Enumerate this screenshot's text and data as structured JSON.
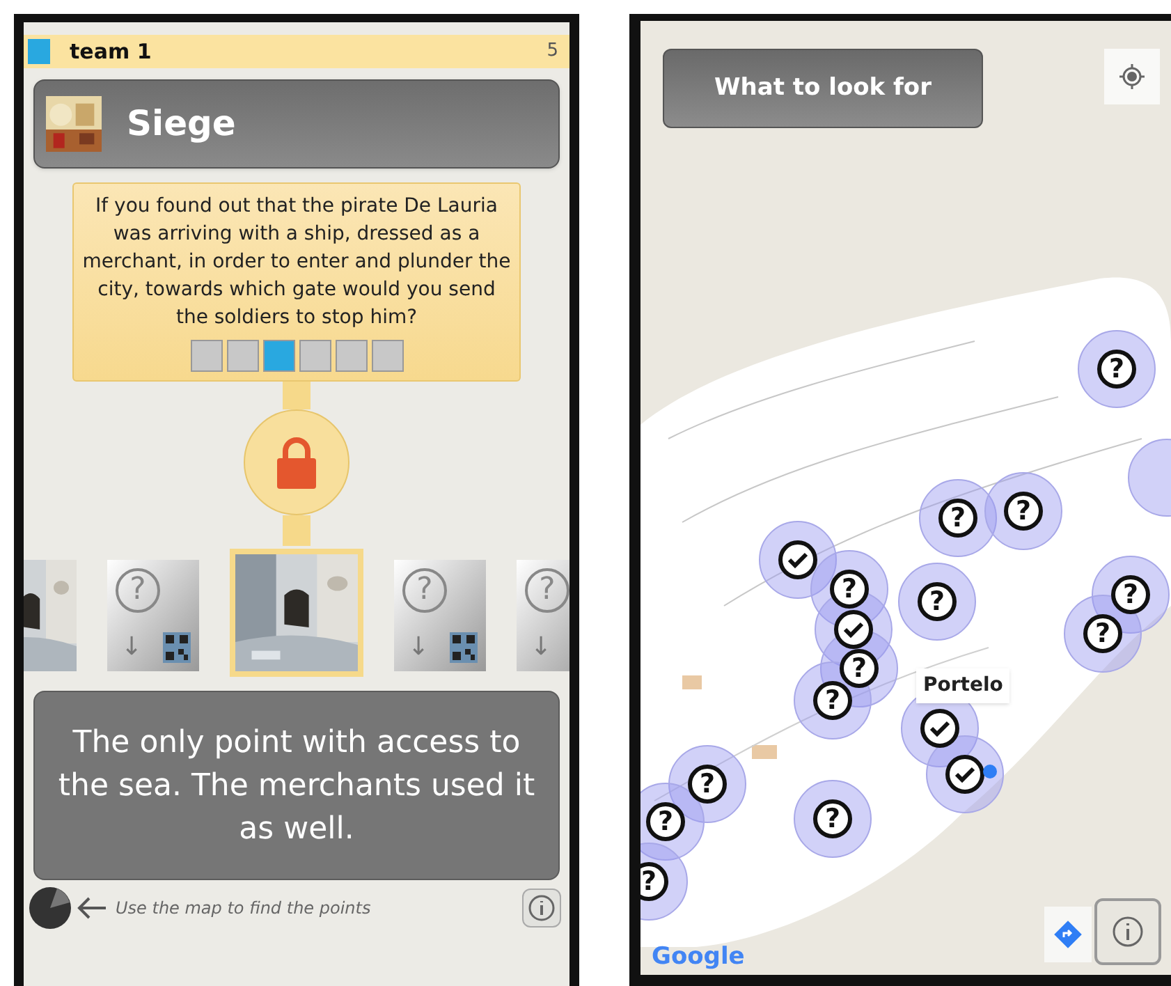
{
  "quiz_screen": {
    "team": {
      "name": "team 1",
      "color": "#29a8e0",
      "score": "5"
    },
    "challenge": {
      "title": "Siege"
    },
    "question": "If you found out that the pirate De Lauria was arriving with a ship, dressed as a merchant, in order to enter and plunder the city, towards which gate would you send the soldiers to stop him?",
    "steps": [
      {
        "selected": false
      },
      {
        "selected": false
      },
      {
        "selected": true
      },
      {
        "selected": false
      },
      {
        "selected": false
      },
      {
        "selected": false
      }
    ],
    "lock": {
      "locked": true
    },
    "cards": [
      {
        "kind": "picture",
        "selected": false
      },
      {
        "kind": "locked",
        "symbol": "?",
        "arrow": "↓",
        "selected": false
      },
      {
        "kind": "picture",
        "selected": true
      },
      {
        "kind": "locked",
        "symbol": "?",
        "arrow": "↓",
        "selected": false
      },
      {
        "kind": "locked",
        "symbol": "?",
        "arrow": "↓",
        "selected": false
      }
    ],
    "description": "The only point with access to the sea. The merchants used it as well.",
    "hint": "Use the map to find the points"
  },
  "map_screen": {
    "what_button": "What to look for",
    "markers": [
      {
        "kind": "question",
        "symbol": "?"
      },
      {
        "kind": "partial"
      },
      {
        "kind": "question",
        "symbol": "?"
      },
      {
        "kind": "question",
        "symbol": "?"
      },
      {
        "kind": "check"
      },
      {
        "kind": "question",
        "symbol": "?"
      },
      {
        "kind": "question",
        "symbol": "?"
      },
      {
        "kind": "question",
        "symbol": "?"
      },
      {
        "kind": "question",
        "symbol": "?"
      },
      {
        "kind": "check"
      },
      {
        "kind": "question",
        "symbol": "?"
      },
      {
        "kind": "question",
        "symbol": "?"
      },
      {
        "kind": "check"
      },
      {
        "kind": "check"
      },
      {
        "kind": "question",
        "symbol": "?"
      },
      {
        "kind": "question",
        "symbol": "?"
      },
      {
        "kind": "question",
        "symbol": "?"
      },
      {
        "kind": "question",
        "symbol": "?"
      }
    ],
    "marker_label": "Portelo",
    "attribution": "Google"
  }
}
